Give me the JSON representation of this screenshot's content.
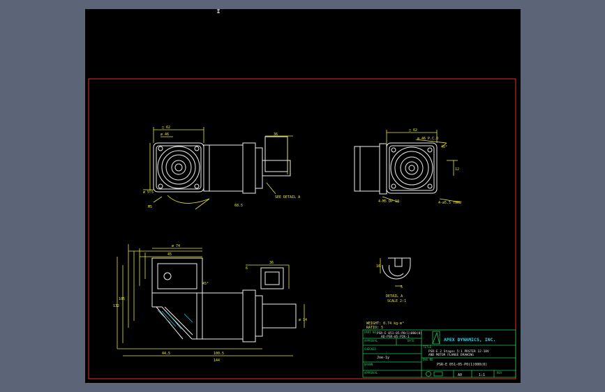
{
  "colors": {
    "background": "#5b6577",
    "viewport": "#000000",
    "border": "#e03030",
    "outline": "#f0f0f0",
    "dimension": "#e8e830",
    "titleblock": "#21c65b",
    "cyan": "#30d0e0"
  },
  "notes": {
    "weight": "WEIGHT: 0.74 kg·m²",
    "ratio": "RATIO: 5"
  },
  "detail": {
    "label": "DETAIL A",
    "scale": "SCALE 2:1"
  },
  "titleblock": {
    "company": "APEX DYNAMICS, INC.",
    "part_no_label": "PART NO",
    "part_no_1": "PSR-E 051-05-P0(1)000(0)",
    "part_no_2": "AD-PSR-05-P2K-1",
    "title_label": "TITLE",
    "title_line_1": "PSR-E 2 Stages 5:1 PRSTER 12-18V",
    "title_line_2": "AND MOTOR FLANGE DRAWING",
    "approval_label": "APPROVAL",
    "date_label": "DATE",
    "checked_label": "CHECKED",
    "checked_value": "Joe-1y",
    "drawn_label": "DRAWN",
    "dwg_no_label": "DWG NO",
    "dwg_no_value": "PSR-E 051-05-P0(1)000(0)",
    "size_value": "A0",
    "scale_value": "1:1",
    "rev_label": "REV"
  }
}
